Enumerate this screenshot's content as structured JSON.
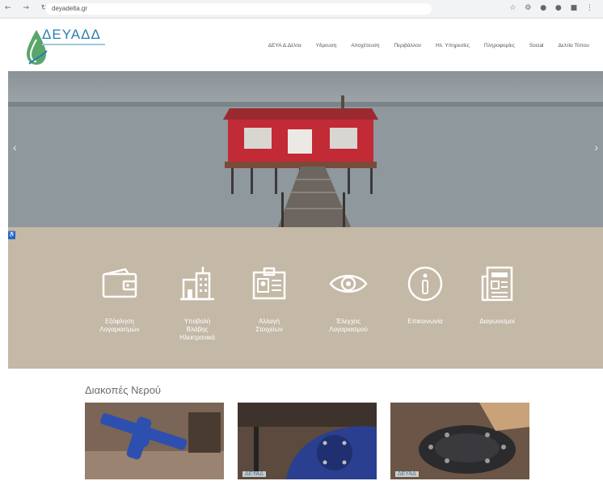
{
  "browser": {
    "url": "deyadelta.gr"
  },
  "header": {
    "logo_text": "ΔΕΥΑΔΔ",
    "menu": [
      "ΔΕΥΑ Δ.Δέλτα",
      "Υδρευση",
      "Αποχέτευση",
      "Περιβάλλον",
      "Ηλ. Υπηρεσίες",
      "Πληροφορίες",
      "Social",
      "Δελτία Τύπου"
    ]
  },
  "hero": {
    "prev_arrow": "‹",
    "next_arrow": "›"
  },
  "accessibility_label": "♿",
  "services": [
    {
      "icon": "wallet-icon",
      "label": [
        "Εξόφληση",
        "Λογαριασμών"
      ]
    },
    {
      "icon": "building-icon",
      "label": [
        "Υποβολή",
        "Βλάβης",
        "Ηλεκτρονικά"
      ]
    },
    {
      "icon": "id-card-icon",
      "label": [
        "Αλλαγή",
        "Στοιχείων"
      ]
    },
    {
      "icon": "eye-icon",
      "label": [
        "Έλεγχος",
        "Λογαριασμού"
      ]
    },
    {
      "icon": "info-icon",
      "label": [
        "Επικοινωνία"
      ]
    },
    {
      "icon": "newspaper-icon",
      "label": [
        "Διαγωνισμοί"
      ]
    }
  ],
  "news": {
    "title": "Διακοπές Νερού",
    "card_brand": "ΔΕΥΑΔ"
  },
  "colors": {
    "band": "#c4b8a6",
    "brand_blue": "#2a7db0",
    "drop_green": "#5aa66a"
  }
}
